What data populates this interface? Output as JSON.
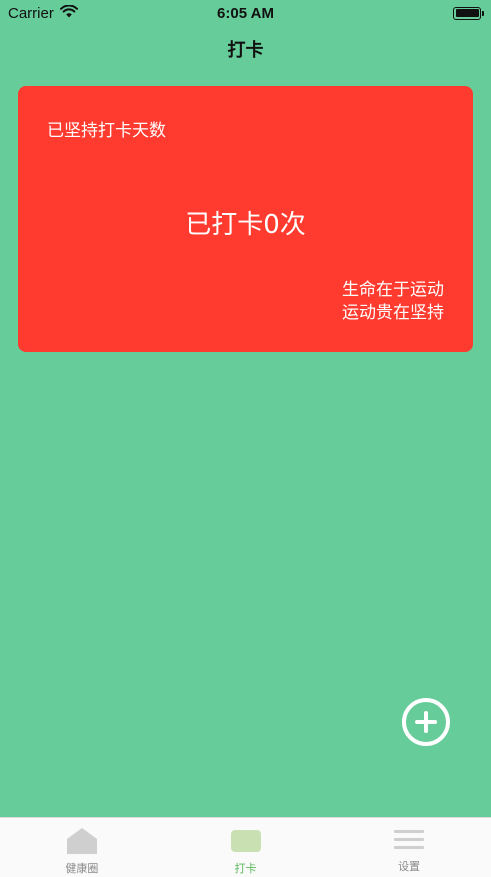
{
  "status_bar": {
    "carrier": "Carrier",
    "time": "6:05 AM"
  },
  "nav": {
    "title": "打卡"
  },
  "card": {
    "label": "已坚持打卡天数",
    "count_text": "已打卡0次",
    "motto_line1": "生命在于运动",
    "motto_line2": "运动贵在坚持",
    "background_color": "#ff3b30"
  },
  "colors": {
    "page_background": "#66cc99",
    "tab_active": "#5cb85c",
    "tab_inactive": "#8a8a8a"
  },
  "tabs": [
    {
      "label": "健康圈",
      "icon": "home-icon",
      "active": false
    },
    {
      "label": "打卡",
      "icon": "checkin-icon",
      "active": true
    },
    {
      "label": "设置",
      "icon": "menu-icon",
      "active": false
    }
  ]
}
